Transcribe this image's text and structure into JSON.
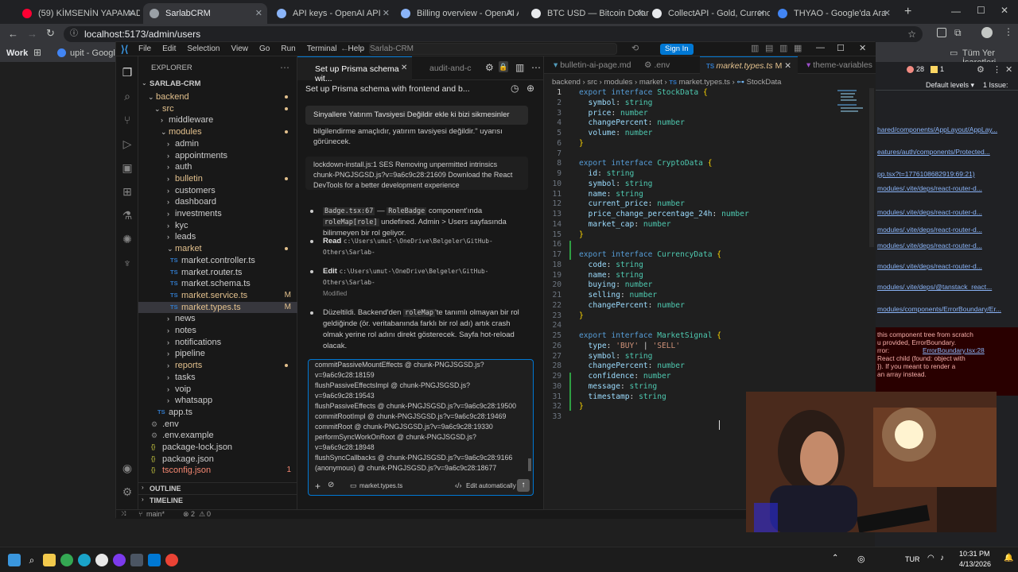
{
  "browser": {
    "tabs": [
      {
        "label": "(59) KİMSENİN YAPAMADIĞI O...",
        "color": "#ff0033"
      },
      {
        "label": "SarlabCRM",
        "color": "#9aa0a6"
      },
      {
        "label": "API keys - OpenAI API",
        "color": "#8ab4f8"
      },
      {
        "label": "Billing overview - OpenAI API",
        "color": "#8ab4f8"
      },
      {
        "label": "BTC USD — Bitcoin Dolar Fiyatı",
        "color": "#e8eaed"
      },
      {
        "label": "CollectAPI - Gold, Currency and...",
        "color": "#e8eaed"
      },
      {
        "label": "THYAO - Google'da Ara",
        "color": "#4285f4"
      }
    ],
    "url": "localhost:5173/admin/users",
    "bookmarks": {
      "work": "Work",
      "upit": "upit - Google'da...",
      "all": "Tüm Yer İşaretleri"
    }
  },
  "vscode": {
    "menu": [
      "File",
      "Edit",
      "Selection",
      "View",
      "Go",
      "Run",
      "Terminal",
      "Help"
    ],
    "search": "Sarlab-CRM",
    "sign_in": "Sign In",
    "explorer": {
      "title": "EXPLORER",
      "root": "SARLAB-CRM",
      "items": [
        {
          "label": "backend",
          "indent": 1,
          "kind": "folder-open",
          "color": "#e2c08d",
          "dot": true
        },
        {
          "label": "src",
          "indent": 2,
          "kind": "folder-open",
          "color": "#e2c08d",
          "dot": true
        },
        {
          "label": "middleware",
          "indent": 3,
          "kind": "folder",
          "color": "#cccccc"
        },
        {
          "label": "modules",
          "indent": 3,
          "kind": "folder-open",
          "color": "#e2c08d",
          "dot": true
        },
        {
          "label": "admin",
          "indent": 4,
          "kind": "folder",
          "color": "#cccccc"
        },
        {
          "label": "appointments",
          "indent": 4,
          "kind": "folder",
          "color": "#cccccc"
        },
        {
          "label": "auth",
          "indent": 4,
          "kind": "folder",
          "color": "#cccccc"
        },
        {
          "label": "bulletin",
          "indent": 4,
          "kind": "folder",
          "color": "#e2c08d",
          "dot": true
        },
        {
          "label": "customers",
          "indent": 4,
          "kind": "folder",
          "color": "#cccccc"
        },
        {
          "label": "dashboard",
          "indent": 4,
          "kind": "folder",
          "color": "#cccccc"
        },
        {
          "label": "investments",
          "indent": 4,
          "kind": "folder",
          "color": "#cccccc"
        },
        {
          "label": "kyc",
          "indent": 4,
          "kind": "folder",
          "color": "#cccccc"
        },
        {
          "label": "leads",
          "indent": 4,
          "kind": "folder",
          "color": "#cccccc"
        },
        {
          "label": "market",
          "indent": 4,
          "kind": "folder-open",
          "color": "#e2c08d",
          "dot": true
        },
        {
          "label": "market.controller.ts",
          "indent": 5,
          "kind": "ts",
          "color": "#cccccc"
        },
        {
          "label": "market.router.ts",
          "indent": 5,
          "kind": "ts",
          "color": "#cccccc"
        },
        {
          "label": "market.schema.ts",
          "indent": 5,
          "kind": "ts",
          "color": "#cccccc"
        },
        {
          "label": "market.service.ts",
          "indent": 5,
          "kind": "ts",
          "color": "#e2c08d",
          "badge": "M"
        },
        {
          "label": "market.types.ts",
          "indent": 5,
          "kind": "ts",
          "color": "#e2c08d",
          "badge": "M",
          "selected": true
        },
        {
          "label": "news",
          "indent": 4,
          "kind": "folder",
          "color": "#cccccc"
        },
        {
          "label": "notes",
          "indent": 4,
          "kind": "folder",
          "color": "#cccccc"
        },
        {
          "label": "notifications",
          "indent": 4,
          "kind": "folder",
          "color": "#cccccc"
        },
        {
          "label": "pipeline",
          "indent": 4,
          "kind": "folder",
          "color": "#cccccc"
        },
        {
          "label": "reports",
          "indent": 4,
          "kind": "folder",
          "color": "#e2c08d",
          "dot": true
        },
        {
          "label": "tasks",
          "indent": 4,
          "kind": "folder",
          "color": "#cccccc"
        },
        {
          "label": "voip",
          "indent": 4,
          "kind": "folder",
          "color": "#cccccc"
        },
        {
          "label": "whatsapp",
          "indent": 4,
          "kind": "folder",
          "color": "#cccccc"
        },
        {
          "label": "app.ts",
          "indent": 3,
          "kind": "ts",
          "color": "#cccccc"
        },
        {
          "label": ".env",
          "indent": 2,
          "kind": "gear",
          "color": "#cccccc"
        },
        {
          "label": ".env.example",
          "indent": 2,
          "kind": "gear",
          "color": "#cccccc"
        },
        {
          "label": "package-lock.json",
          "indent": 2,
          "kind": "json",
          "color": "#cccccc"
        },
        {
          "label": "package.json",
          "indent": 2,
          "kind": "json",
          "color": "#cccccc"
        },
        {
          "label": "tsconfig.json",
          "indent": 2,
          "kind": "json",
          "color": "#f48771",
          "badge": "1"
        }
      ],
      "outline": "OUTLINE",
      "timeline": "TIMELINE"
    },
    "chat": {
      "tab_title": "Set up Prisma schema wit...",
      "tab2": "audit-and-c",
      "header": "Set up Prisma schema with frontend and b...",
      "user_msg": "Sinyallere Yatırım Tavsiyesi Değildir ekle ki bizi sikmesinler",
      "partial_text": "bilgilendirme amaçlıdır, yatırım tavsiyesi değildir.\" uyarısı görünecek.",
      "lockdown": "lockdown-install.js:1 SES Removing unpermitted intrinsics",
      "lockdown2": "chunk-PNGJSGSD.js?v=9a6c9c28:21609 Download the React DevTools for a better development experience",
      "step1_code1": "Badge.tsx:67",
      "step1_dash": "—",
      "step1_code2": "RoleBadge",
      "step1_mid": "component'ında",
      "step1_code3": "roleMap[role]",
      "step1_rest": "undefined. Admin > Users sayfasında bilinmeyen bir rol geliyor.",
      "step2_label": "Read",
      "step2_path": "c:\\Users\\umut-\\OneDrive\\Belgeler\\GitHub- Others\\Sarlab-CRM\\frontend\\src\\shared\\components\\Badge\\Badge.tsx (lines 56-...",
      "step3_label": "Edit",
      "step3_path": "c:\\Users\\umut-\\OneDrive\\Belgeler\\GitHub- Others\\Sarlab-CRM\\frontend\\src\\shared\\components\\Badge\\Badge.tsx",
      "step3_status": "Modified",
      "step4_a": "Düzeltildi. Backend'den",
      "step4_code": "roleMap",
      "step4_b": "'te tanımlı olmayan bir rol geldiğinde (ör. veritabanında farklı bir rol adı) artık crash olmak yerine rol adını direkt gösterecek. Sayfa hot-reload olacak.",
      "input_lines": [
        "commitPassiveMountEffects @ chunk-PNGJSGSD.js?",
        "v=9a6c9c28:18159",
        "flushPassiveEffectsImpl @ chunk-PNGJSGSD.js?",
        "v=9a6c9c28:19543",
        "flushPassiveEffects @ chunk-PNGJSGSD.js?v=9a6c9c28:19500",
        "commitRootImpl @ chunk-PNGJSGSD.js?v=9a6c9c28:19469",
        "commitRoot @ chunk-PNGJSGSD.js?v=9a6c9c28:19330",
        "performSyncWorkOnRoot @ chunk-PNGJSGSD.js?",
        "v=9a6c9c28:18948",
        "flushSyncCallbacks @ chunk-PNGJSGSD.js?v=9a6c9c28:9166",
        "(anonymous) @ chunk-PNGJSGSD.js?v=9a6c9c28:18677"
      ],
      "context_file": "market.types.ts",
      "mode": "Edit automatically"
    },
    "editor": {
      "tabs": [
        "bulletin-ai-page.md",
        ".env",
        "market.types.ts",
        "theme-variables"
      ],
      "active_badge": "M",
      "breadcrumb": [
        "backend",
        "src",
        "modules",
        "market",
        "market.types.ts",
        "StockData"
      ],
      "lines": [
        [
          [
            "kw",
            "export "
          ],
          [
            "kw",
            "interface "
          ],
          [
            "ty",
            "StockData "
          ],
          [
            "br",
            "{"
          ]
        ],
        [
          [
            "nm",
            "  symbol"
          ],
          [
            "pu",
            ": "
          ],
          [
            "ty",
            "string"
          ]
        ],
        [
          [
            "nm",
            "  price"
          ],
          [
            "pu",
            ": "
          ],
          [
            "ty",
            "number"
          ]
        ],
        [
          [
            "nm",
            "  changePercent"
          ],
          [
            "pu",
            ": "
          ],
          [
            "ty",
            "number"
          ]
        ],
        [
          [
            "nm",
            "  volume"
          ],
          [
            "pu",
            ": "
          ],
          [
            "ty",
            "number"
          ]
        ],
        [
          [
            "br",
            "}"
          ]
        ],
        [],
        [
          [
            "kw",
            "export "
          ],
          [
            "kw",
            "interface "
          ],
          [
            "ty",
            "CryptoData "
          ],
          [
            "br",
            "{"
          ]
        ],
        [
          [
            "nm",
            "  id"
          ],
          [
            "pu",
            ": "
          ],
          [
            "ty",
            "string"
          ]
        ],
        [
          [
            "nm",
            "  symbol"
          ],
          [
            "pu",
            ": "
          ],
          [
            "ty",
            "string"
          ]
        ],
        [
          [
            "nm",
            "  name"
          ],
          [
            "pu",
            ": "
          ],
          [
            "ty",
            "string"
          ]
        ],
        [
          [
            "nm",
            "  current_price"
          ],
          [
            "pu",
            ": "
          ],
          [
            "ty",
            "number"
          ]
        ],
        [
          [
            "nm",
            "  price_change_percentage_24h"
          ],
          [
            "pu",
            ": "
          ],
          [
            "ty",
            "number"
          ]
        ],
        [
          [
            "nm",
            "  market_cap"
          ],
          [
            "pu",
            ": "
          ],
          [
            "ty",
            "number"
          ]
        ],
        [
          [
            "br",
            "}"
          ]
        ],
        [],
        [
          [
            "kw",
            "export "
          ],
          [
            "kw",
            "interface "
          ],
          [
            "ty",
            "CurrencyData "
          ],
          [
            "br",
            "{"
          ]
        ],
        [
          [
            "nm",
            "  code"
          ],
          [
            "pu",
            ": "
          ],
          [
            "ty",
            "string"
          ]
        ],
        [
          [
            "nm",
            "  name"
          ],
          [
            "pu",
            ": "
          ],
          [
            "ty",
            "string"
          ]
        ],
        [
          [
            "nm",
            "  buying"
          ],
          [
            "pu",
            ": "
          ],
          [
            "ty",
            "number"
          ]
        ],
        [
          [
            "nm",
            "  selling"
          ],
          [
            "pu",
            ": "
          ],
          [
            "ty",
            "number"
          ]
        ],
        [
          [
            "nm",
            "  changePercent"
          ],
          [
            "pu",
            ": "
          ],
          [
            "ty",
            "number"
          ]
        ],
        [
          [
            "br",
            "}"
          ]
        ],
        [],
        [
          [
            "kw",
            "export "
          ],
          [
            "kw",
            "interface "
          ],
          [
            "ty",
            "MarketSignal "
          ],
          [
            "br",
            "{"
          ]
        ],
        [
          [
            "nm",
            "  type"
          ],
          [
            "pu",
            ": "
          ],
          [
            "st",
            "'BUY'"
          ],
          [
            "pu",
            " | "
          ],
          [
            "st",
            "'SELL'"
          ]
        ],
        [
          [
            "nm",
            "  symbol"
          ],
          [
            "pu",
            ": "
          ],
          [
            "ty",
            "string"
          ]
        ],
        [
          [
            "nm",
            "  changePercent"
          ],
          [
            "pu",
            ": "
          ],
          [
            "ty",
            "number"
          ]
        ],
        [
          [
            "nm",
            "  confidence"
          ],
          [
            "pu",
            ": "
          ],
          [
            "ty",
            "number"
          ]
        ],
        [
          [
            "nm",
            "  message"
          ],
          [
            "pu",
            ": "
          ],
          [
            "ty",
            "string"
          ]
        ],
        [
          [
            "nm",
            "  timestamp"
          ],
          [
            "pu",
            ": "
          ],
          [
            "ty",
            "string"
          ]
        ],
        [
          [
            "br",
            "}"
          ]
        ],
        []
      ]
    },
    "status": {
      "branch": "main*",
      "errors": "2",
      "warnings": "0"
    }
  },
  "devtools": {
    "errors": "28",
    "warnings": "1",
    "levels": "Default levels ▾",
    "issues": "1 Issue:",
    "links": [
      "hared/components/AppLayout/AppLay...",
      "eatures/auth/components/Protected...",
      "pp.tsx?t=1776108682919:69:21)",
      "modules/.vite/deps/react-router-d...",
      "modules/.vite/deps/react-router-d...",
      "modules/.vite/deps/react-router-d...",
      "modules/.vite/deps/react-router-d...",
      "modules/.vite/deps/react-router-d...",
      "modules/.vite/deps/@tanstack_react...",
      "modules/components/ErrorBoundary/Er..."
    ],
    "error_text": [
      "this component tree from scratch",
      "u provided, ErrorBoundary.",
      "rror:",
      "React child (found: object with",
      "}). If you meant to render a",
      " an array instead."
    ],
    "error_link": "ErrorBoundary.tsx:28"
  },
  "taskbar": {
    "lang": "TUR",
    "time": "10:31 PM",
    "date": "4/13/2026"
  }
}
